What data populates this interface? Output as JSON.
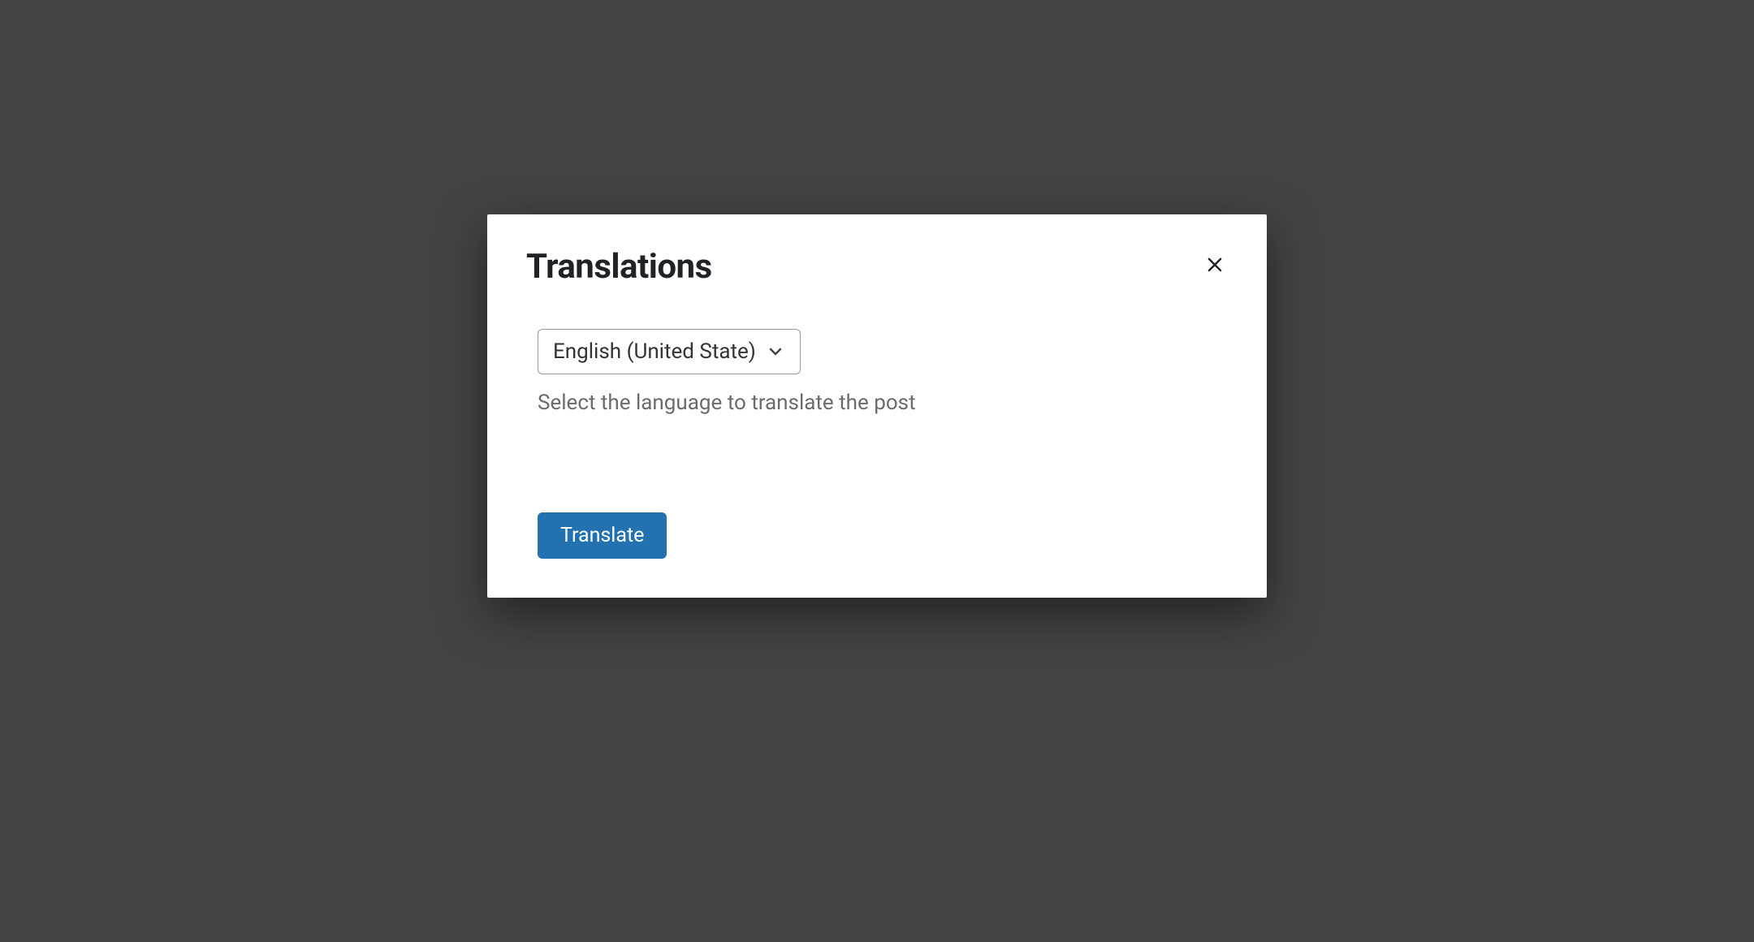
{
  "modal": {
    "title": "Translations",
    "language_select": {
      "selected": "English (United State)"
    },
    "helper_text": "Select the language to translate the post",
    "translate_button_label": "Translate"
  }
}
